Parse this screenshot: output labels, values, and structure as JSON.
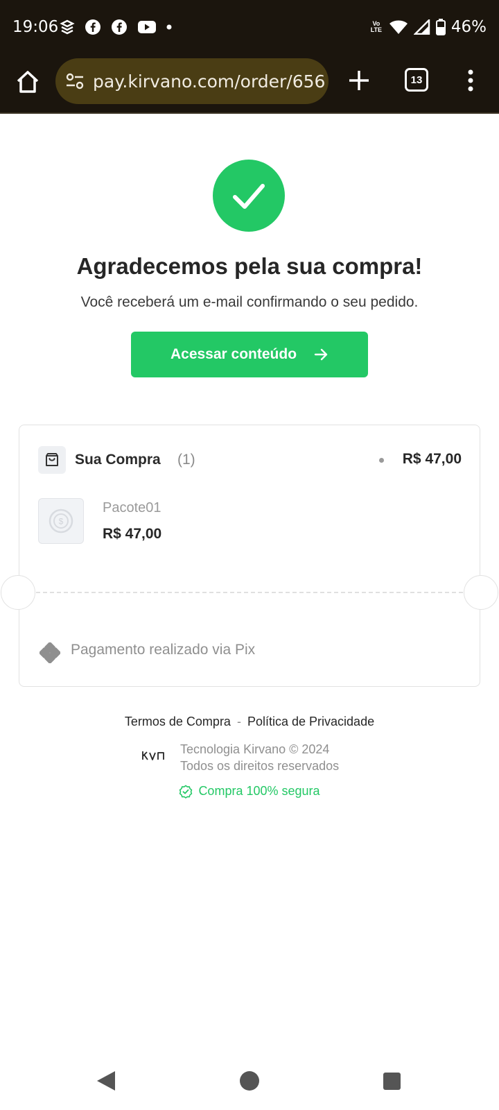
{
  "status_bar": {
    "time": "19:06",
    "battery": "46%",
    "network": "Vo LTE",
    "notification_icons": [
      "stack-icon",
      "facebook-icon",
      "facebook-icon",
      "youtube-icon",
      "dot-icon"
    ]
  },
  "browser": {
    "url": "pay.kirvano.com/order/656",
    "tab_count": "13"
  },
  "page": {
    "title": "Agradecemos pela sua compra!",
    "subtitle": "Você receberá um e-mail confirmando o seu pedido.",
    "cta_label": "Acessar conteúdo"
  },
  "order": {
    "label": "Sua Compra",
    "count": "(1)",
    "total": "R$ 47,00",
    "items": [
      {
        "name": "Pacote01",
        "price": "R$ 47,00"
      }
    ],
    "payment": "Pagamento realizado via Pix"
  },
  "footer": {
    "terms": "Termos de Compra",
    "separator": "-",
    "privacy": "Política de Privacidade",
    "logo": "KVN",
    "company_line1": "Tecnologia Kirvano © 2024",
    "company_line2": "Todos os direitos reservados",
    "secure": "Compra 100% segura"
  },
  "colors": {
    "accent_green": "#23c865",
    "toolbar_bg": "#1b150d",
    "url_bar_bg": "#4a3d14"
  }
}
